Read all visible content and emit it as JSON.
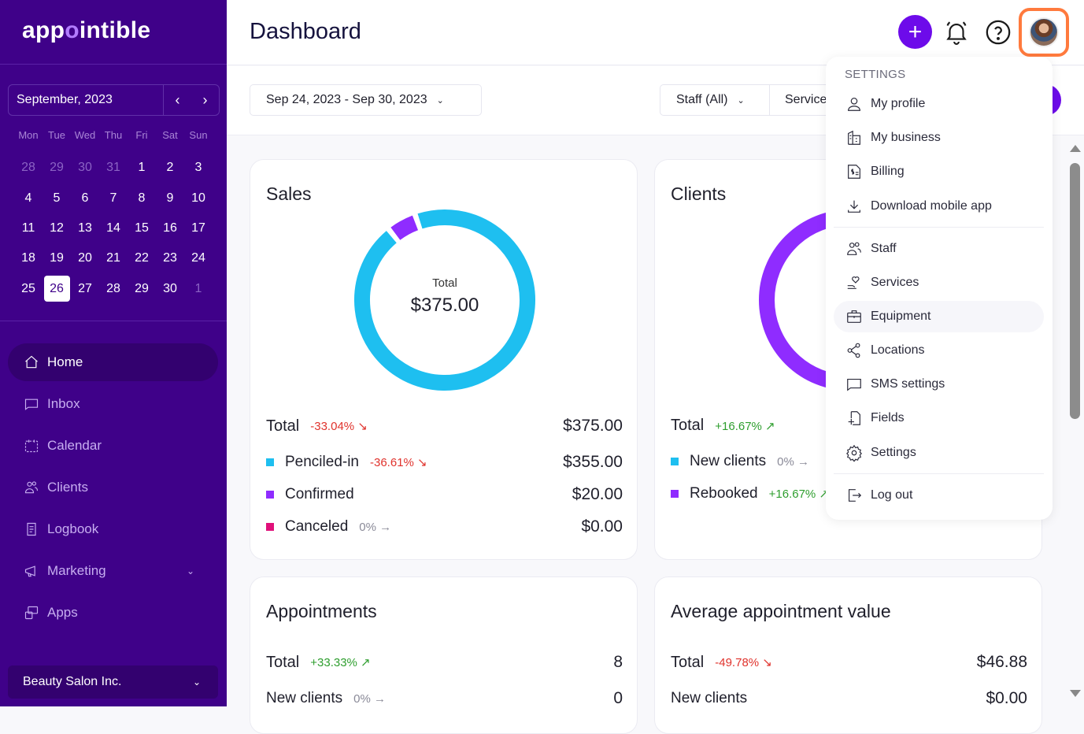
{
  "app": {
    "logo_pre": "app",
    "logo_o": "o",
    "logo_post": "intible"
  },
  "calendar": {
    "month_label": "September, 2023",
    "prev_icon": "‹",
    "next_icon": "›",
    "weekdays": [
      "Mon",
      "Tue",
      "Wed",
      "Thu",
      "Fri",
      "Sat",
      "Sun"
    ],
    "days": [
      {
        "d": "28",
        "muted": true
      },
      {
        "d": "29",
        "muted": true
      },
      {
        "d": "30",
        "muted": true
      },
      {
        "d": "31",
        "muted": true
      },
      {
        "d": "1"
      },
      {
        "d": "2"
      },
      {
        "d": "3"
      },
      {
        "d": "4"
      },
      {
        "d": "5"
      },
      {
        "d": "6"
      },
      {
        "d": "7"
      },
      {
        "d": "8"
      },
      {
        "d": "9"
      },
      {
        "d": "10"
      },
      {
        "d": "11"
      },
      {
        "d": "12"
      },
      {
        "d": "13"
      },
      {
        "d": "14"
      },
      {
        "d": "15"
      },
      {
        "d": "16"
      },
      {
        "d": "17"
      },
      {
        "d": "18"
      },
      {
        "d": "19"
      },
      {
        "d": "20"
      },
      {
        "d": "21"
      },
      {
        "d": "22"
      },
      {
        "d": "23"
      },
      {
        "d": "24"
      },
      {
        "d": "25"
      },
      {
        "d": "26",
        "today": true
      },
      {
        "d": "27"
      },
      {
        "d": "28"
      },
      {
        "d": "29"
      },
      {
        "d": "30"
      },
      {
        "d": "1",
        "muted": true
      }
    ]
  },
  "nav": {
    "items": [
      {
        "label": "Home",
        "icon": "home-icon",
        "active": true
      },
      {
        "label": "Inbox",
        "icon": "inbox-icon"
      },
      {
        "label": "Calendar",
        "icon": "calendar-icon"
      },
      {
        "label": "Clients",
        "icon": "clients-icon"
      },
      {
        "label": "Logbook",
        "icon": "logbook-icon"
      },
      {
        "label": "Marketing",
        "icon": "megaphone-icon",
        "has_chevron": true
      },
      {
        "label": "Apps",
        "icon": "apps-icon"
      }
    ],
    "business_name": "Beauty Salon Inc.",
    "chevron": "⌄"
  },
  "header": {
    "title": "Dashboard",
    "add_icon": "+"
  },
  "filters": {
    "date_range": "Sep 24, 2023 - Sep 30, 2023",
    "staff": "Staff (All)",
    "service": "Services",
    "chevron": "⌄"
  },
  "sales": {
    "title": "Sales",
    "center_label": "Total",
    "center_value": "$375.00",
    "total_label": "Total",
    "total_pct": "-33.04% ↘",
    "total_value": "$375.00",
    "rows": [
      {
        "label": "Penciled-in",
        "pct": "-36.61% ↘",
        "trend": "neg",
        "value": "$355.00",
        "color": "#1ebff0"
      },
      {
        "label": "Confirmed",
        "pct": "",
        "trend": "",
        "value": "$20.00",
        "color": "#8f2cff"
      },
      {
        "label": "Canceled",
        "pct": "0% →",
        "trend": "neu",
        "value": "$0.00",
        "color": "#e0107a"
      }
    ]
  },
  "clients": {
    "title": "Clients",
    "total_label": "Total",
    "total_pct": "+16.67% ↗",
    "rows": [
      {
        "label": "New clients",
        "pct": "0% →",
        "trend": "neu",
        "color": "#1ebff0"
      },
      {
        "label": "Rebooked",
        "pct": "+16.67% ↗",
        "trend": "pos",
        "color": "#8f2cff"
      }
    ]
  },
  "appointments": {
    "title": "Appointments",
    "total_label": "Total",
    "total_pct": "+33.33% ↗",
    "total_value": "8",
    "new_label": "New clients",
    "new_pct": "0% →",
    "new_value": "0"
  },
  "avg_value": {
    "title": "Average appointment value",
    "total_label": "Total",
    "total_pct": "-49.78% ↘",
    "total_value": "$46.88",
    "new_label": "New clients",
    "new_value": "$0.00"
  },
  "menu": {
    "heading": "SETTINGS",
    "items": [
      {
        "label": "My profile",
        "icon": "user-icon"
      },
      {
        "label": "My business",
        "icon": "building-icon"
      },
      {
        "label": "Billing",
        "icon": "billing-icon"
      },
      {
        "label": "Download mobile app",
        "icon": "download-icon"
      },
      {
        "label": "Staff",
        "icon": "staff-icon"
      },
      {
        "label": "Services",
        "icon": "services-icon"
      },
      {
        "label": "Equipment",
        "icon": "briefcase-icon"
      },
      {
        "label": "Locations",
        "icon": "share-icon"
      },
      {
        "label": "SMS settings",
        "icon": "message-icon"
      },
      {
        "label": "Fields",
        "icon": "file-add-icon"
      },
      {
        "label": "Settings",
        "icon": "gear-icon"
      },
      {
        "label": "Log out",
        "icon": "logout-icon"
      }
    ]
  },
  "chart_data": [
    {
      "type": "pie",
      "title": "Sales",
      "categories": [
        "Penciled-in",
        "Confirmed",
        "Canceled"
      ],
      "values": [
        355,
        20,
        0
      ],
      "colors": [
        "#1ebff0",
        "#8f2cff",
        "#e0107a"
      ],
      "center_text": "$375.00"
    },
    {
      "type": "pie",
      "title": "Clients",
      "categories": [
        "New clients",
        "Rebooked"
      ],
      "values": [
        0,
        1
      ],
      "colors": [
        "#1ebff0",
        "#8f2cff"
      ]
    }
  ]
}
